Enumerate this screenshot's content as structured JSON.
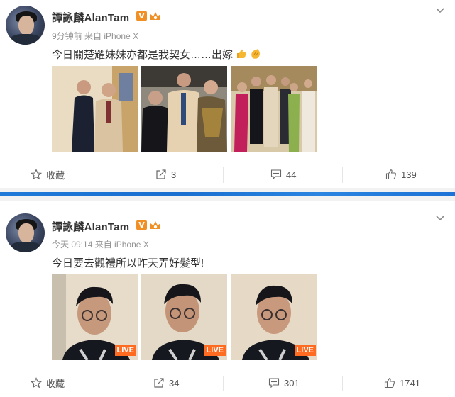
{
  "posts": [
    {
      "author": "譚詠麟AlanTam",
      "badge": "V",
      "time": "9分钟前",
      "source": "来自 iPhone X",
      "text": "今日關楚耀妹妹亦都是我契女……出嫁",
      "actions": {
        "favorite": "收藏",
        "repost": "3",
        "comment": "44",
        "like": "139"
      }
    },
    {
      "author": "譚詠麟AlanTam",
      "badge": "V",
      "time": "今天 09:14",
      "source": "来自 iPhone X",
      "text": "今日要去觀禮所以昨天弄好髮型!",
      "photos_live": [
        "LIVE",
        "LIVE",
        "LIVE"
      ],
      "actions": {
        "favorite": "收藏",
        "repost": "34",
        "comment": "301",
        "like": "1741"
      }
    }
  ],
  "colors": {
    "accent_orange": "#f08f24",
    "live_orange": "#ff6b21",
    "divider_blue": "#1f7ad8"
  }
}
